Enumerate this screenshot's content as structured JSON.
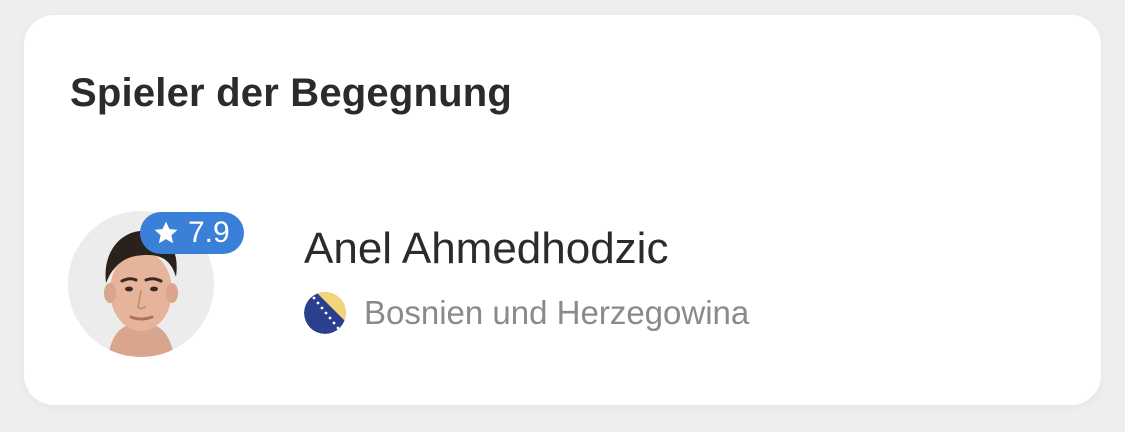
{
  "card": {
    "title": "Spieler der Begegnung"
  },
  "player": {
    "name": "Anel Ahmedhodzic",
    "rating": "7.9",
    "rating_icon": "star-icon",
    "country": "Bosnien und Herzegowina",
    "flag_icon": "bosnia-herzegovina-flag-icon",
    "avatar_icon": "player-photo"
  },
  "colors": {
    "badge": "#3a7fd8",
    "title_text": "#2b2b2b",
    "secondary_text": "#8a8a8a",
    "flag_blue": "#2b3f8f",
    "flag_yellow": "#f2d479"
  }
}
